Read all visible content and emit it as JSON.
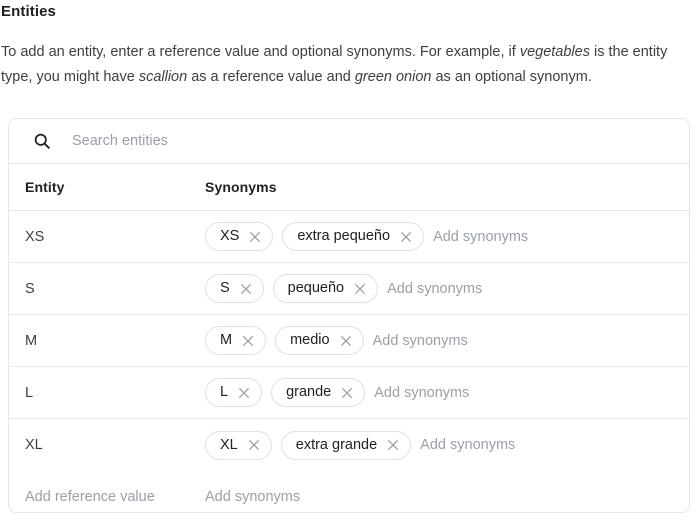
{
  "page": {
    "title": "Entities",
    "description_parts": [
      {
        "text": "To add an entity, enter a reference value and optional synonyms. For example, if ",
        "italic": false
      },
      {
        "text": "vegetables",
        "italic": true
      },
      {
        "text": " is the entity type, you might have ",
        "italic": false
      },
      {
        "text": "scallion",
        "italic": true
      },
      {
        "text": " as a reference value and ",
        "italic": false
      },
      {
        "text": "green onion",
        "italic": true
      },
      {
        "text": " as an optional synonym.",
        "italic": false
      }
    ]
  },
  "search": {
    "icon": "search-icon",
    "placeholder": "Search entities",
    "value": ""
  },
  "table": {
    "columns": [
      "Entity",
      "Synonyms"
    ],
    "add_synonyms_placeholder": "Add synonyms",
    "add_reference_placeholder": "Add reference value",
    "rows": [
      {
        "entity": "XS",
        "synonyms": [
          "XS",
          "extra pequeño"
        ]
      },
      {
        "entity": "S",
        "synonyms": [
          "S",
          "pequeño"
        ]
      },
      {
        "entity": "M",
        "synonyms": [
          "M",
          "medio"
        ]
      },
      {
        "entity": "L",
        "synonyms": [
          "L",
          "grande"
        ]
      },
      {
        "entity": "XL",
        "synonyms": [
          "XL",
          "extra grande"
        ]
      }
    ]
  },
  "colors": {
    "text_primary": "#202124",
    "text_secondary": "#3c4043",
    "text_placeholder": "#9aa0a6",
    "border": "#e4e6e8",
    "row_divider": "#e8eaed",
    "chip_border": "#dfe1e5",
    "background": "#ffffff"
  }
}
